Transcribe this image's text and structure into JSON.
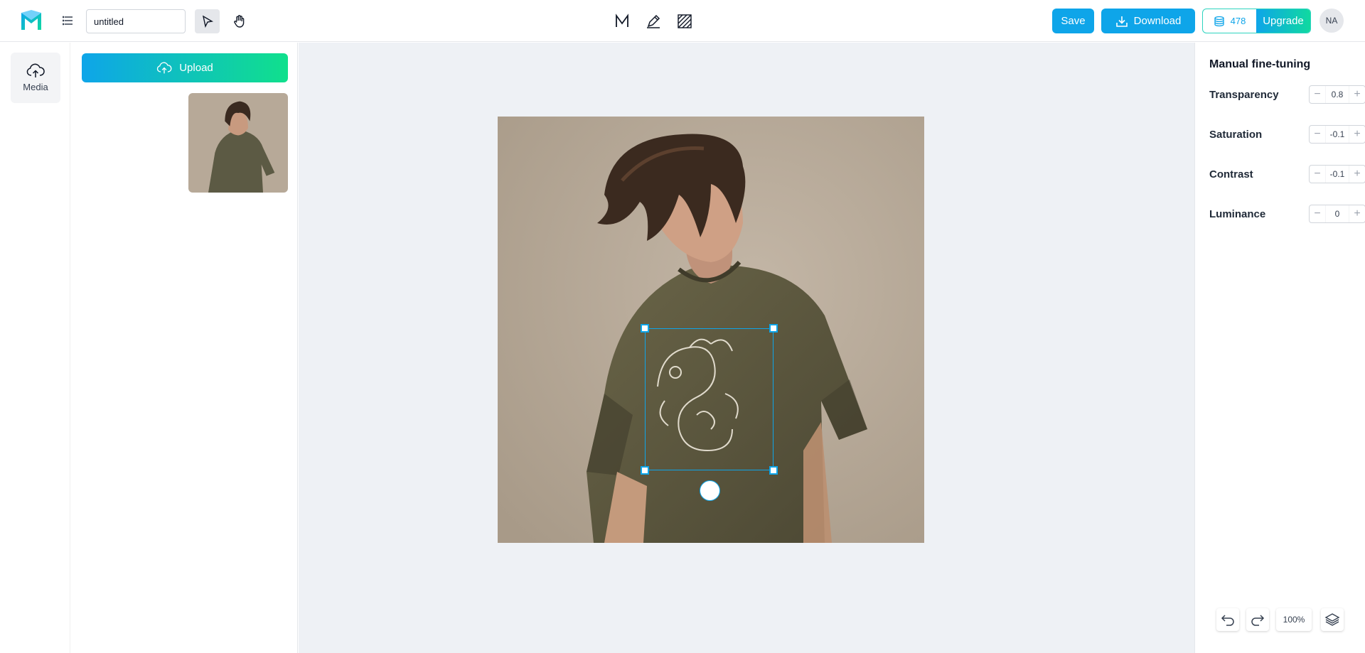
{
  "app": {
    "document_title": "untitled"
  },
  "toolbar": {
    "save_label": "Save",
    "download_label": "Download",
    "credits_count": "478",
    "upgrade_label": "Upgrade",
    "avatar_initials": "NA"
  },
  "rail": {
    "items": [
      {
        "label": "Media",
        "icon": "cloud-upload-icon"
      }
    ]
  },
  "media": {
    "upload_label": "Upload"
  },
  "adjustments": {
    "title": "Manual fine-tuning",
    "rows": [
      {
        "label": "Transparency",
        "value": "0.8"
      },
      {
        "label": "Saturation",
        "value": "-0.1"
      },
      {
        "label": "Contrast",
        "value": "-0.1"
      },
      {
        "label": "Luminance",
        "value": "0"
      }
    ]
  },
  "zoom": {
    "level": "100%"
  },
  "colors": {
    "accent": "#0ea5e9",
    "accent_green": "#10e08c",
    "canvas_bg": "#eef1f5",
    "teal_border": "#2dd4bf"
  }
}
